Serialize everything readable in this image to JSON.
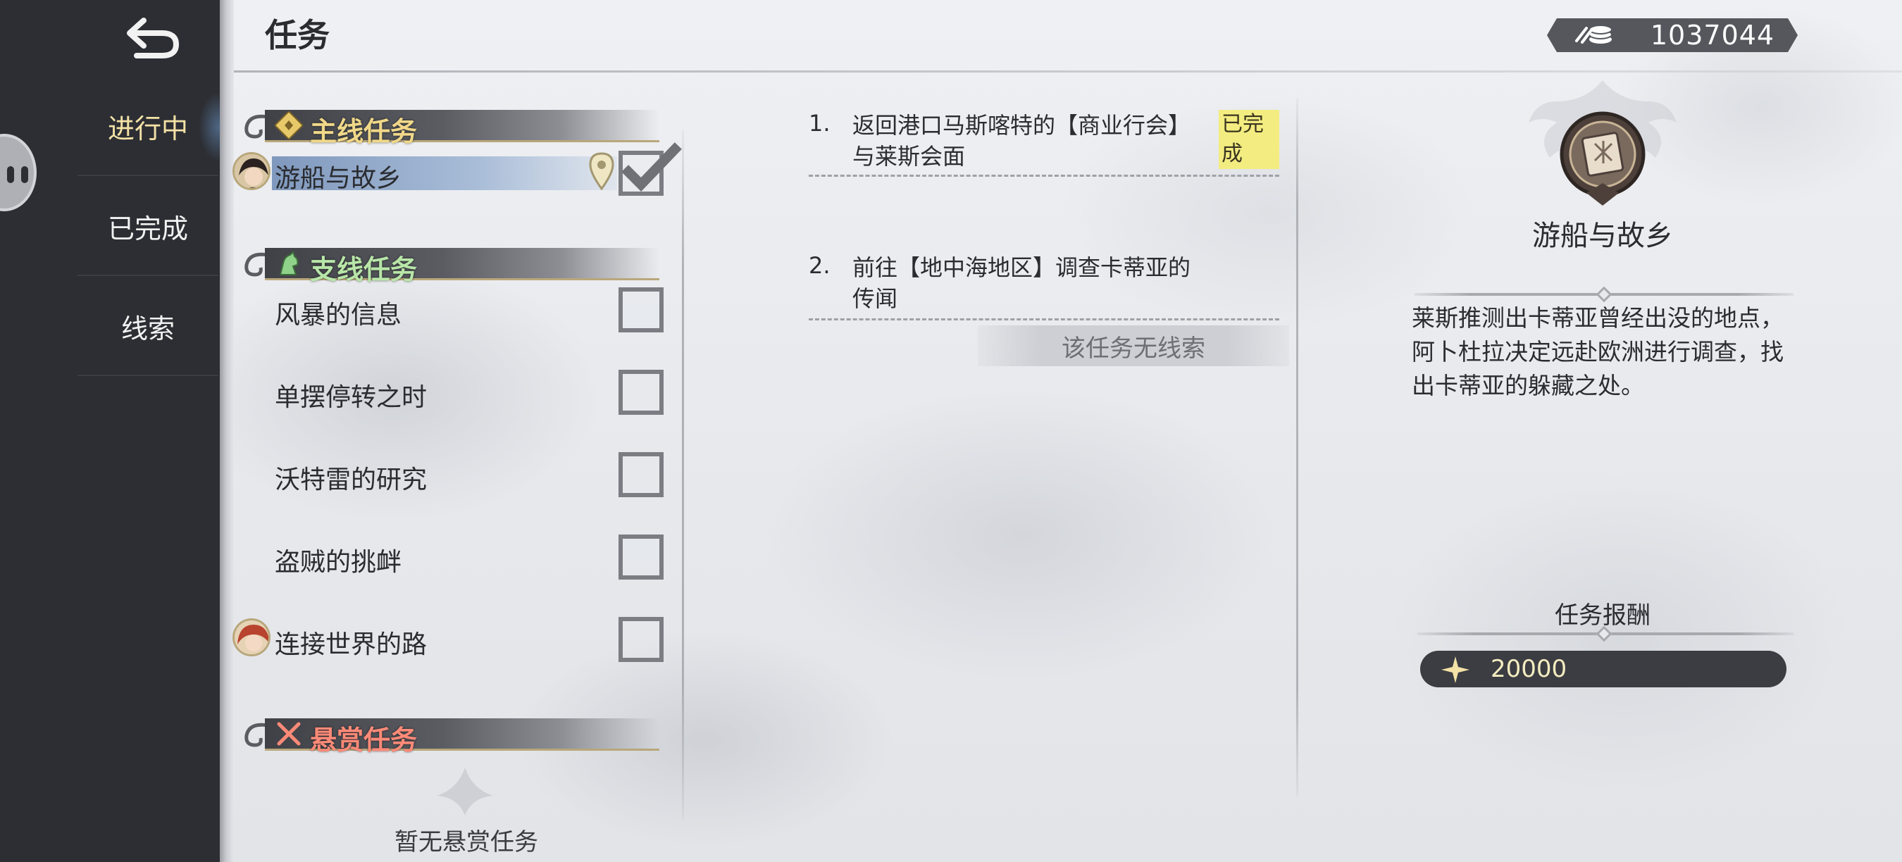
{
  "header": {
    "title": "任务",
    "currency_value": "1037044",
    "currency_icon": "coin-stack-icon"
  },
  "sidebar": {
    "back_icon": "back-arrow-icon",
    "items": [
      {
        "label": "进行中",
        "active": true
      },
      {
        "label": "已完成",
        "active": false
      },
      {
        "label": "线索",
        "active": false
      }
    ]
  },
  "quest_list": {
    "main": {
      "label": "主线任务",
      "quests": [
        {
          "name": "游船与故乡",
          "selected": true,
          "checked": true
        }
      ]
    },
    "side": {
      "label": "支线任务",
      "quests": [
        {
          "name": "风暴的信息",
          "checked": false
        },
        {
          "name": "单摆停转之时",
          "checked": false
        },
        {
          "name": "沃特雷的研究",
          "checked": false
        },
        {
          "name": "盗贼的挑衅",
          "checked": false
        },
        {
          "name": "连接世界的路",
          "checked": false
        }
      ]
    },
    "bounty": {
      "label": "悬赏任务",
      "empty_text": "暂无悬赏任务"
    }
  },
  "objectives": [
    {
      "num": "1.",
      "text": "返回港口马斯喀特的【商业行会】与莱斯会面",
      "line1": "返回港口马斯喀特的【商业行会】",
      "line2": "与莱斯会面",
      "status": "已完成"
    },
    {
      "num": "2.",
      "text": "前往【地中海地区】调查卡蒂亚的传闻",
      "line1": "前往【地中海地区】调查卡蒂亚的",
      "line2": "传闻",
      "status": ""
    }
  ],
  "no_clue_text": "该任务无线索",
  "detail": {
    "title": "游船与故乡",
    "description": "莱斯推测出卡蒂亚曾经出没的地点，阿卜杜拉决定远赴欧洲进行调查，找出卡蒂亚的躲藏之处。",
    "desc_line1": "莱斯推测出卡蒂亚曾经出没的地点，",
    "desc_line2": "阿卜杜拉决定远赴欧洲进行调查，找",
    "desc_line3": "出卡蒂亚的躲藏之处。",
    "reward_title": "任务报酬",
    "reward_value": "20000",
    "reward_icon": "sparkle-icon"
  },
  "colors": {
    "sidebar_bg": "#2c2e33",
    "active_nav": "#f4e2a6",
    "main_quest_label": "#f0d889",
    "side_quest_label": "#b8e6a8",
    "bounty_label": "#ff8a78",
    "selected_row": "#a9bdd8",
    "completed_tag": "#f3ec80"
  }
}
